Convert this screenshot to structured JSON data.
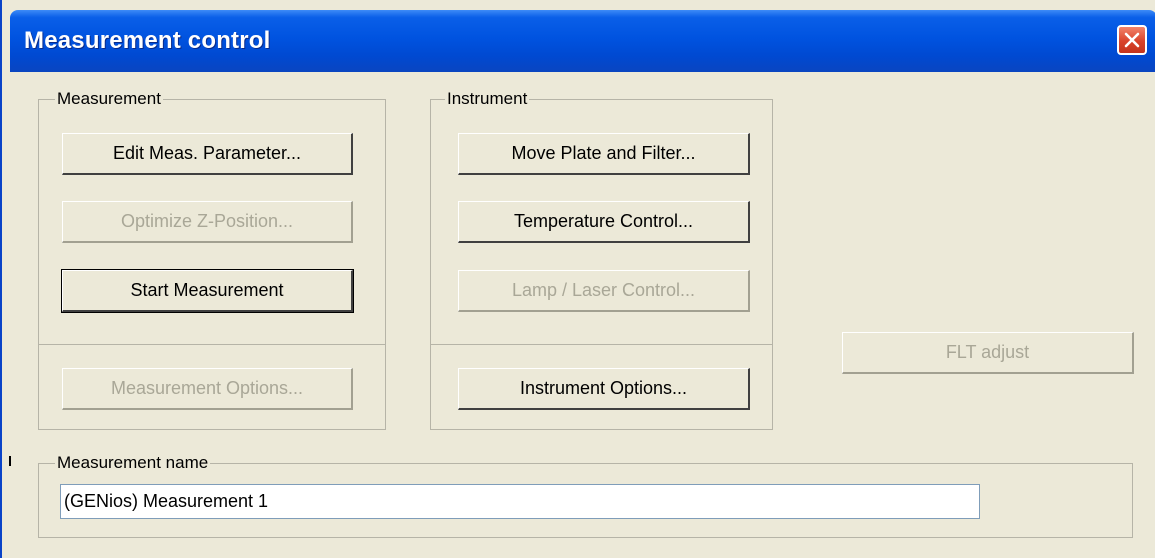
{
  "window": {
    "title": "Measurement control"
  },
  "measurement_group": {
    "label": "Measurement",
    "edit_params": "Edit Meas. Parameter...",
    "optimize_z": "Optimize Z-Position...",
    "start": "Start Measurement",
    "options": "Measurement Options..."
  },
  "instrument_group": {
    "label": "Instrument",
    "move_plate": "Move Plate and Filter...",
    "temperature": "Temperature Control...",
    "lamp_laser": "Lamp / Laser Control...",
    "options": "Instrument Options..."
  },
  "flt_adjust": "FLT adjust",
  "name_group": {
    "label": "Measurement name",
    "value": "(GENios) Measurement 1"
  },
  "colors": {
    "title_bar": "#0053e0",
    "dialog_bg": "#ece9d8",
    "close_button": "#d9432b",
    "disabled_text": "#a9a797"
  }
}
